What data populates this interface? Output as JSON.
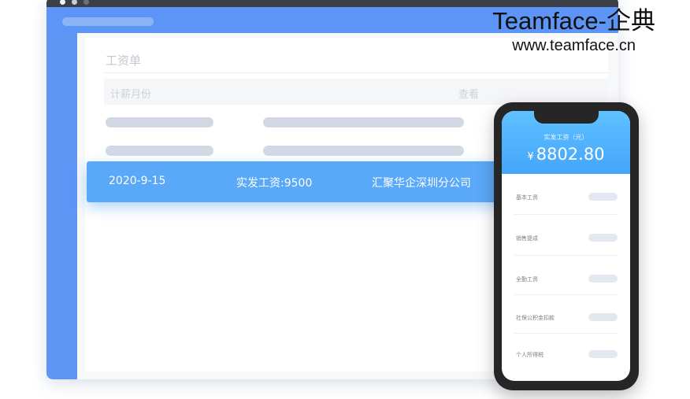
{
  "brand": {
    "name": "Teamface-企典",
    "url": "www.teamface.cn"
  },
  "window": {
    "page_title": "工资单",
    "filter": {
      "label": "计薪月份",
      "view_action": "查看"
    }
  },
  "record": {
    "date": "2020-9-15",
    "salary": "实发工资:9500",
    "company": "汇聚华企深圳分公司"
  },
  "phone": {
    "header_label": "实发工资（元）",
    "currency_symbol": "¥",
    "amount": "8802.80",
    "items": [
      {
        "label": "基本工资"
      },
      {
        "label": "销售提成"
      },
      {
        "label": "全勤工资"
      },
      {
        "label": "社保公积金扣款"
      },
      {
        "label": "个人所得税"
      }
    ]
  },
  "colors": {
    "accent_blue": "#5d95f6",
    "record_blue": "#5aa8f8",
    "phone_header_top": "#5fc1ff",
    "phone_header_bottom": "#44a5fb",
    "skeleton": "#d3d9e4"
  }
}
